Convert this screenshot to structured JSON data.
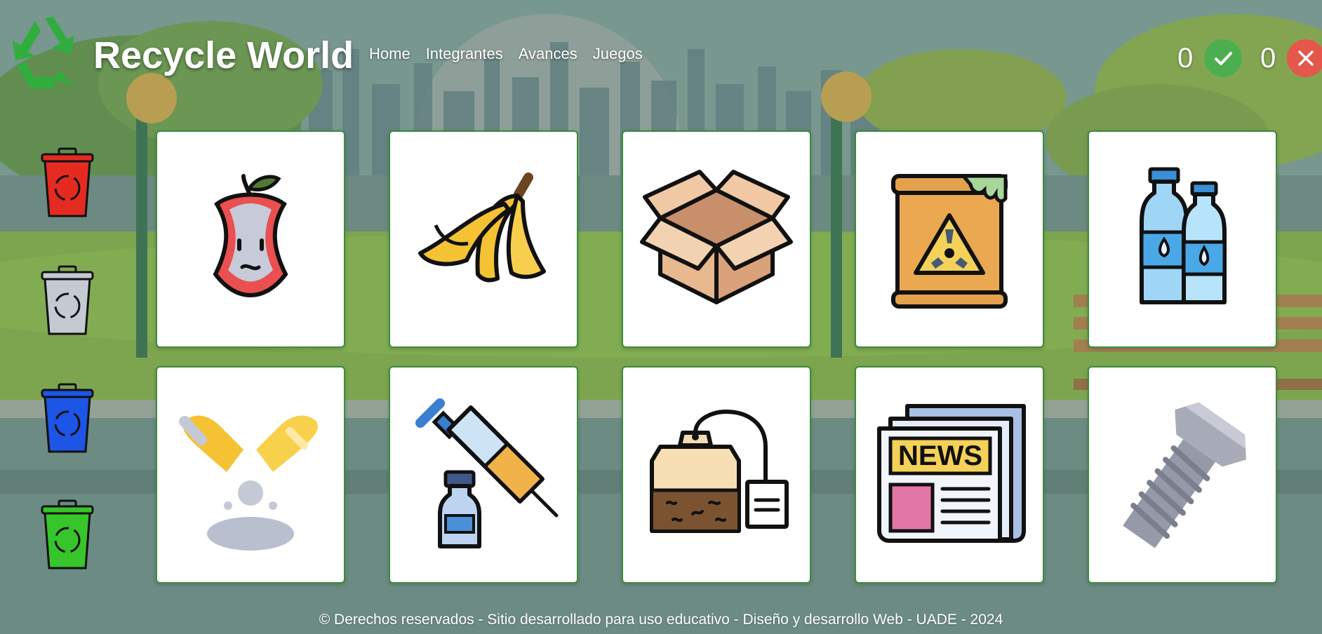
{
  "header": {
    "title": "Recycle World",
    "logo_icon": "recycle-logo-icon",
    "nav": [
      {
        "label": "Home"
      },
      {
        "label": "Integrantes"
      },
      {
        "label": "Avances"
      },
      {
        "label": "Juegos"
      }
    ]
  },
  "score": {
    "correct": "0",
    "wrong": "0",
    "correct_icon": "check-icon",
    "wrong_icon": "close-icon",
    "correct_color": "#4cae4f",
    "wrong_color": "#e4574b"
  },
  "bins": [
    {
      "color": "#e52b21",
      "icon": "red-recycle-bin-icon"
    },
    {
      "color": "#c5c9d2",
      "icon": "gray-recycle-bin-icon"
    },
    {
      "color": "#1d55e6",
      "icon": "blue-recycle-bin-icon"
    },
    {
      "color": "#37c52c",
      "icon": "green-recycle-bin-icon"
    }
  ],
  "items": [
    {
      "icon": "apple-core-icon"
    },
    {
      "icon": "banana-peel-icon"
    },
    {
      "icon": "cardboard-box-icon"
    },
    {
      "icon": "toxic-barrel-icon"
    },
    {
      "icon": "plastic-bottles-icon"
    },
    {
      "icon": "broken-egg-icon"
    },
    {
      "icon": "syringe-and-vial-icon"
    },
    {
      "icon": "tea-bag-icon"
    },
    {
      "icon": "newspaper-icon"
    },
    {
      "icon": "metal-bolt-icon"
    }
  ],
  "newspaper_text": "NEWS",
  "footer": {
    "text": "© Derechos reservados - Sitio desarrollado para uso educativo - Diseño y desarrollo Web - UADE - 2024"
  }
}
